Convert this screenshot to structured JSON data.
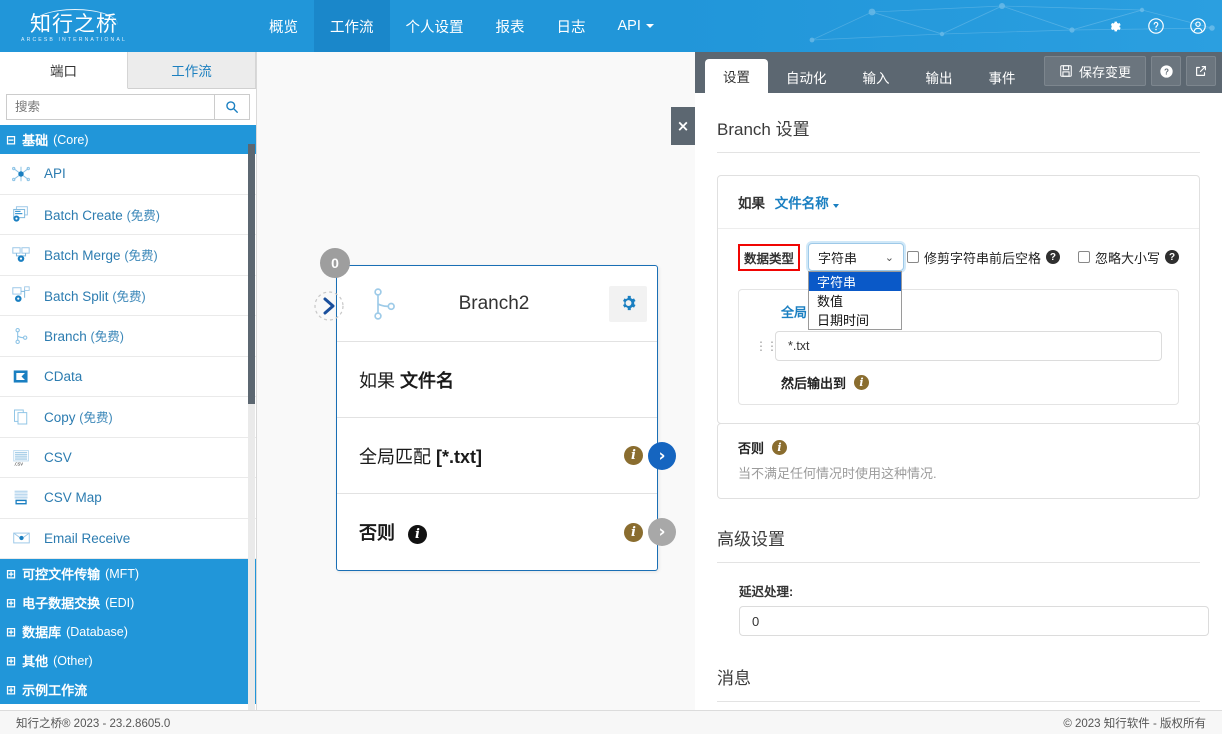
{
  "header": {
    "logo_cn": "知行之桥",
    "logo_en": "ARCESB INTERNATIONAL",
    "nav": [
      {
        "label": "概览",
        "active": false
      },
      {
        "label": "工作流",
        "active": true
      },
      {
        "label": "个人设置",
        "active": false
      },
      {
        "label": "报表",
        "active": false
      },
      {
        "label": "日志",
        "active": false
      },
      {
        "label": "API",
        "active": false,
        "has_caret": true
      }
    ],
    "icons": [
      "gear-icon",
      "help-icon",
      "account-icon"
    ],
    "bg_color": "#2196d9"
  },
  "sidebar": {
    "tabs": [
      {
        "label": "端口",
        "active": true
      },
      {
        "label": "工作流",
        "active": false
      }
    ],
    "search": {
      "value": "",
      "placeholder": "搜索",
      "button_icon": "search-icon"
    },
    "groups": [
      {
        "label": "基础",
        "suffix": "(Core)",
        "expanded": true,
        "toggle": "⊟",
        "items": [
          {
            "label": "API",
            "free": "",
            "icon": "api-icon"
          },
          {
            "label": "Batch Create",
            "free": "(免费)",
            "icon": "batch-create-icon"
          },
          {
            "label": "Batch Merge",
            "free": "(免费)",
            "icon": "batch-merge-icon"
          },
          {
            "label": "Batch Split",
            "free": "(免费)",
            "icon": "batch-split-icon"
          },
          {
            "label": "Branch",
            "free": "(免费)",
            "icon": "branch-icon"
          },
          {
            "label": "CData",
            "free": "",
            "icon": "cdata-icon"
          },
          {
            "label": "Copy",
            "free": "(免费)",
            "icon": "copy-icon"
          },
          {
            "label": "CSV",
            "free": "",
            "icon": "csv-icon"
          },
          {
            "label": "CSV Map",
            "free": "",
            "icon": "csv-map-icon"
          },
          {
            "label": "Email Receive",
            "free": "",
            "icon": "email-receive-icon"
          }
        ]
      },
      {
        "label": "可控文件传输",
        "suffix": "(MFT)",
        "expanded": false,
        "toggle": "⊞",
        "items": []
      },
      {
        "label": "电子数据交换",
        "suffix": "(EDI)",
        "expanded": false,
        "toggle": "⊞",
        "items": []
      },
      {
        "label": "数据库",
        "suffix": "(Database)",
        "expanded": false,
        "toggle": "⊞",
        "items": []
      },
      {
        "label": "其他",
        "suffix": "(Other)",
        "expanded": false,
        "toggle": "⊞",
        "items": []
      },
      {
        "label": "示例工作流",
        "suffix": "",
        "expanded": false,
        "toggle": "⊞",
        "items": []
      }
    ],
    "collapse_handle": "‹"
  },
  "canvas": {
    "node": {
      "badge": "0",
      "title": "Branch2",
      "gear_icon": "gear-icon",
      "branch_icon": "branch-icon",
      "rows": [
        {
          "prefix": "如果",
          "value": "文件名",
          "has_info": false,
          "has_arrow": false
        },
        {
          "prefix": "全局匹配",
          "value": "[*.txt]",
          "has_info": true,
          "has_arrow": true,
          "arrow_state": "blue"
        },
        {
          "prefix": "否则",
          "value": "",
          "has_info": true,
          "has_inline_info": true,
          "has_arrow": true,
          "arrow_state": "gray"
        }
      ]
    }
  },
  "right_panel": {
    "close_button": "×",
    "tabs": [
      {
        "label": "设置",
        "active": true
      },
      {
        "label": "自动化",
        "active": false
      },
      {
        "label": "输入",
        "active": false
      },
      {
        "label": "输出",
        "active": false
      },
      {
        "label": "事件",
        "active": false
      }
    ],
    "save_label": "保存变更",
    "save_icon": "save-icon",
    "help_icon": "help-icon",
    "popout_icon": "external-link-icon",
    "section_title": "Branch 设置",
    "condition": {
      "if_keyword": "如果",
      "field_label": "文件名称",
      "datatype_label": "数据类型",
      "datatype_value": "字符串",
      "datatype_options": [
        {
          "label": "字符串",
          "selected": true
        },
        {
          "label": "数值",
          "selected": false
        },
        {
          "label": "日期时间",
          "selected": false
        }
      ],
      "checkboxes": [
        {
          "label": "修剪字符串前后空格",
          "checked": false
        },
        {
          "label": "忽略大小写",
          "checked": false
        }
      ],
      "match_mode": "全局匹配",
      "match_value": "*.txt",
      "then_output_label": "然后输出到"
    },
    "else_block": {
      "title": "否则",
      "description": "当不满足任何情况时使用这种情况."
    },
    "advanced": {
      "title": "高级设置",
      "delay_label": "延迟处理:",
      "delay_value": "0"
    },
    "messages_title": "消息"
  },
  "footer": {
    "left": "知行之桥® 2023 - 23.2.8605.0",
    "right": "© 2023 知行软件 - 版权所有"
  }
}
